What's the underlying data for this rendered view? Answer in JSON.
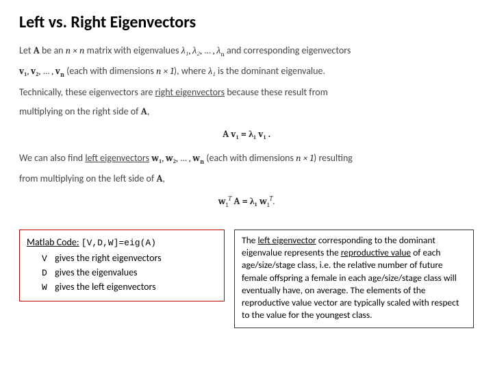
{
  "title": "Left vs. Right Eigenvectors",
  "p1a": "Let ",
  "p1b": " be an ",
  "p1c": " matrix with eigenvalues ",
  "p1d": " and corresponding eigenvectors",
  "p2a": " (each with dimensions ",
  "p2b": "), where ",
  "p2c": " is the dominant eigenvalue.",
  "p3a": "Technically, these eigenvectors are ",
  "p3b": "right eigenvectors",
  "p3c": " because these result from",
  "p4a": "multiplying on the right side of ",
  "p4b": ",",
  "eq1": "A v₁ = λ₁ v₁ .",
  "p5a": "We can also find ",
  "p5b": "left eigenvectors",
  "p5c": " (each with dimensions ",
  "p5d": ") resulting",
  "p6a": "from multiplying on the left side of ",
  "p6b": ",",
  "eq2_left": "w",
  "eq2_sub": "1",
  "eq2_supT": "T",
  "eq2_mid": " A = λ₁ ",
  "eq2_right": "w",
  "eq2_dot": ".",
  "matlab": {
    "head_label": "Matlab Code:",
    "code": "[V,D,W]=eig(A)",
    "rows": [
      {
        "var": "V",
        "desc": "gives the right eigenvectors"
      },
      {
        "var": "D",
        "desc": "gives the eigenvalues"
      },
      {
        "var": "W",
        "desc": "gives the left eigenvectors"
      }
    ]
  },
  "right_box": {
    "t1": "The ",
    "t2": "left eigenvector",
    "t3": " corresponding to the dominant eigenvalue represents the ",
    "t4": "reproductive value",
    "t5": " of each age/size/stage class, i.e. the relative number of future female offspring a female in each age/size/stage class will eventually have, on average. The elements of the reproductive value vector are typically scaled with respect to the value for the youngest class."
  },
  "sym": {
    "A": "A",
    "nxn": "n × n",
    "lam1": "λ₁",
    "lam2": "λ₂",
    "lamn": "λ",
    "nsub": "n",
    "v1": "v₁",
    "v2": "v₂",
    "vn": "v",
    "w1": "w₁",
    "w2": "w₂",
    "wn": "w",
    "nx1": "n × 1",
    "dots": ", … , ",
    "comma": ", "
  }
}
